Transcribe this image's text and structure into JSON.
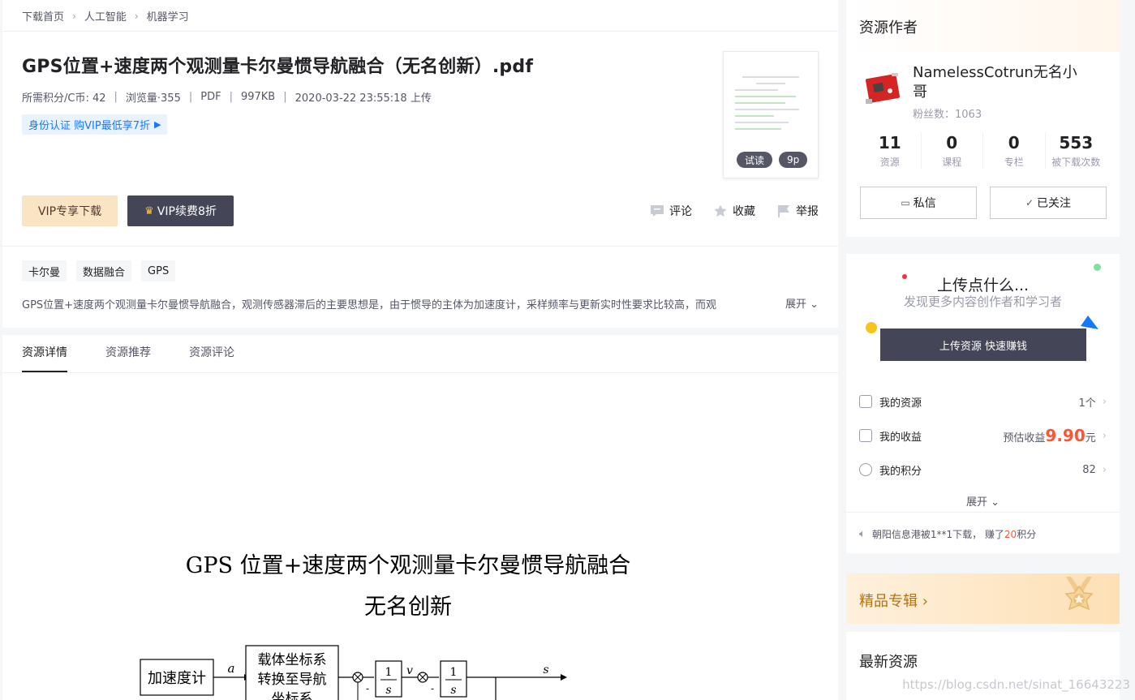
{
  "breadcrumb": [
    "下载首页",
    "人工智能",
    "机器学习"
  ],
  "resource": {
    "title": "GPS位置+速度两个观测量卡尔曼惯导航融合（无名创新）.pdf",
    "meta": [
      "所需积分/C币: 42",
      "浏览量·355",
      "PDF",
      "997KB",
      "2020-03-22 23:55:18 上传"
    ],
    "vip_tip": "身份认证 购VIP最低享7折",
    "preview_badges": [
      "试读",
      "9p"
    ],
    "tags": [
      "卡尔曼",
      "数据融合",
      "GPS"
    ],
    "description": "GPS位置+速度两个观测量卡尔曼惯导航融合，观测传感器滞后的主要思想是，由于惯导的主体为加速度计，采样频率与更新实时性要求比较高，而观",
    "expand_label": "展开"
  },
  "buttons": {
    "vip_download": "VIP专享下载",
    "vip_renew": "VIP续费8折",
    "comment": "评论",
    "favorite": "收藏",
    "report": "举报"
  },
  "tabs": [
    {
      "label": "资源详情",
      "active": true
    },
    {
      "label": "资源推荐",
      "active": false
    },
    {
      "label": "资源评论",
      "active": false
    }
  ],
  "document_preview": {
    "title_line1": "GPS 位置+速度两个观测量卡尔曼惯导航融合",
    "title_line2": "无名创新",
    "diagram": {
      "block_accel": "加速度计",
      "block_transform": [
        "载体坐标系",
        "转换至导航",
        "坐标系"
      ],
      "signal_a": "a",
      "signal_v": "v",
      "signal_s": "s",
      "integrator_num": "1",
      "integrator_den": "s",
      "minus": "-"
    }
  },
  "author": {
    "header": "资源作者",
    "name": "NamelessCotrun无名小哥",
    "fans_label": "粉丝数：1063",
    "stats": [
      {
        "value": "11",
        "label": "资源"
      },
      {
        "value": "0",
        "label": "课程"
      },
      {
        "value": "0",
        "label": "专栏"
      },
      {
        "value": "553",
        "label": "被下载次数"
      }
    ],
    "message_button": "私信",
    "follow_button": "已关注"
  },
  "upload": {
    "title": "上传点什么...",
    "subtitle": "发现更多内容创作者和学习者",
    "button": "上传资源 快速赚钱",
    "rows": [
      {
        "label": "我的资源",
        "value": "1个"
      },
      {
        "label": "我的收益",
        "prefix": "预估收益",
        "value": "9.90",
        "suffix": "元"
      },
      {
        "label": "我的积分",
        "value": "82"
      }
    ],
    "expand": "展开",
    "notice_prefix": "朝阳信息港被1**1下载，  赚了",
    "notice_points": "20",
    "notice_suffix": "积分"
  },
  "featured": {
    "title": "精品专辑"
  },
  "latest": {
    "title": "最新资源"
  },
  "watermark": "https://blog.csdn.net/sinat_16643223",
  "colors": {
    "accent_orange": "#fc5531",
    "dark_button": "#444556",
    "vip_gold": "#f9e5c4",
    "link_blue": "#1677ff"
  }
}
